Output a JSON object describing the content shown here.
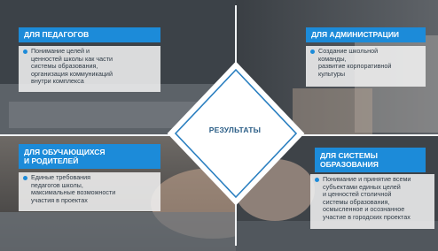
{
  "center": {
    "title": "РЕЗУЛЬТАТЫ"
  },
  "quadrants": {
    "teachers": {
      "heading": "ДЛЯ ПЕДАГОГОВ",
      "text": "Понимание целей и\nценностей школы как части\nсистемы образования,\nорганизация коммуникаций\nвнутри комплекса"
    },
    "administration": {
      "heading": "ДЛЯ АДМИНИСТРАЦИИ",
      "text": "Создание школьной\nкоманды,\nразвитие корпоративной\nкультуры"
    },
    "students": {
      "heading": "ДЛЯ ОБУЧАЮЩИХСЯ\nИ РОДИТЕЛЕЙ",
      "text": "Единые требования\nпедагогов школы,\nмаксимальные возможности\nучастия в проектах"
    },
    "system": {
      "heading": "ДЛЯ СИСТЕМЫ\nОБРАЗОВАНИЯ",
      "text": "Понимание и принятие всеми\nсубъектами единых целей\nи ценностей столичной\nсистемы образования,\nосмысленное и осознанное\nучастие в городских проектах"
    }
  },
  "colors": {
    "accent": "#1c8bd9",
    "panel": "#f0f0f0",
    "text": "#2f3b46"
  }
}
